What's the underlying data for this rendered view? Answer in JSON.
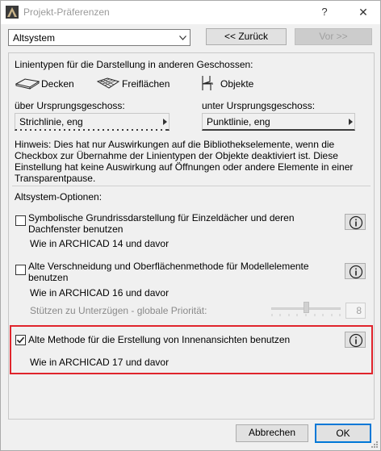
{
  "window": {
    "title": "Projekt-Präferenzen",
    "help_label": "?",
    "close_label": "✕"
  },
  "top": {
    "preset_value": "Altsystem",
    "back_label": "<< Zurück",
    "forward_label": "Vor >>"
  },
  "linetypes": {
    "heading": "Linientypen für die Darstellung in anderen Geschossen:",
    "categories": [
      "Decken",
      "Freiflächen",
      "Objekte"
    ],
    "above_label": "über Ursprungsgeschoss:",
    "above_value": "Strichlinie, eng",
    "below_label": "unter Ursprungsgeschoss:",
    "below_value": "Punktlinie, eng",
    "note": "Hinweis: Dies hat nur Auswirkungen auf die Bibliothekselemente, wenn die Checkbox zur Übernahme der Linientypen der Objekte deaktiviert ist. Diese Einstellung hat keine Auswirkung auf Öffnungen oder andere Elemente in einer Transparentpause."
  },
  "options": {
    "heading": "Altsystem-Optionen:",
    "items": [
      {
        "label": "Symbolische Grundrissdarstellung für Einzeldächer und deren Dachfenster benutzen",
        "checked": false,
        "note": "Wie in ARCHICAD 14 und davor"
      },
      {
        "label": "Alte Verschneidung und Oberflächenmethode für Modellelemente benutzen",
        "checked": false,
        "note": "Wie in ARCHICAD 16 und davor"
      },
      {
        "label": "Alte Methode für die Erstellung von Innenansichten benutzen",
        "checked": true,
        "note": "Wie in ARCHICAD 17 und davor"
      }
    ],
    "priority_label": "Stützen zu Unterzügen - globale Priorität:",
    "priority_value": "8",
    "priority_level": 0.5
  },
  "footer": {
    "cancel_label": "Abbrechen",
    "ok_label": "OK"
  },
  "colors": {
    "highlight": "#e0242c",
    "default_button_border": "#0078d7"
  }
}
